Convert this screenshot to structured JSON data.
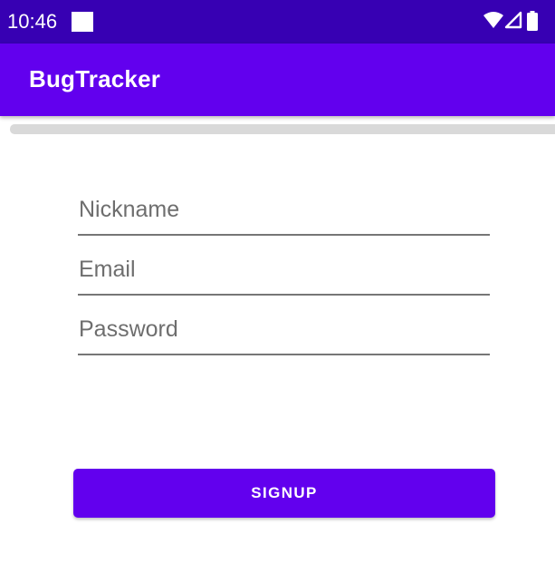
{
  "status_bar": {
    "time": "10:46",
    "icons": [
      "wifi-icon",
      "signal-icon",
      "battery-icon"
    ],
    "background": "#3700B3"
  },
  "app_bar": {
    "title": "BugTracker",
    "background": "#6200EE"
  },
  "form": {
    "nickname": {
      "placeholder": "Nickname",
      "value": ""
    },
    "email": {
      "placeholder": "Email",
      "value": ""
    },
    "password": {
      "placeholder": "Password",
      "value": ""
    },
    "signup_label": "SIGNUP"
  },
  "colors": {
    "primary": "#6200EE",
    "primary_dark": "#3700B3"
  }
}
